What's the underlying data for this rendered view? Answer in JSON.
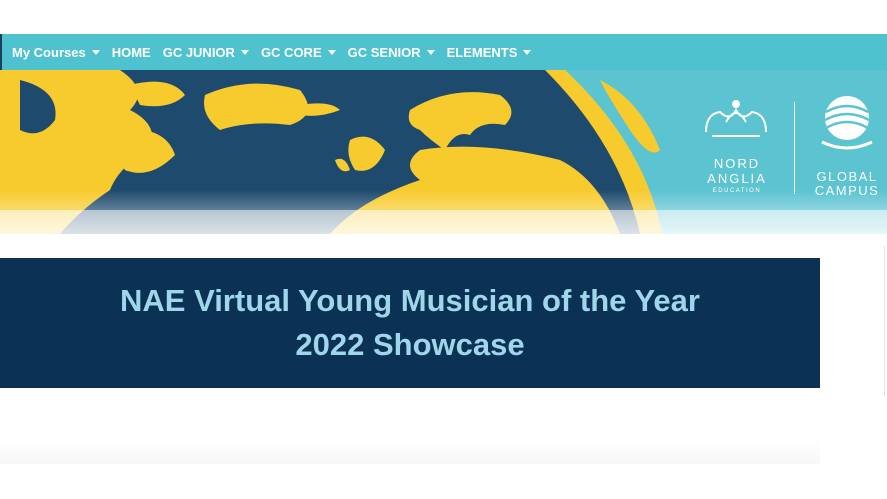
{
  "nav": {
    "items": [
      {
        "label": "My Courses",
        "dropdown": true
      },
      {
        "label": "HOME",
        "dropdown": false
      },
      {
        "label": "GC JUNIOR",
        "dropdown": true
      },
      {
        "label": "GC CORE",
        "dropdown": true
      },
      {
        "label": "GC SENIOR",
        "dropdown": true
      },
      {
        "label": "ELEMENTS",
        "dropdown": true
      }
    ]
  },
  "logos": {
    "nord_anglia": {
      "line1": "NORD",
      "line2": "ANGLIA",
      "line3": "EDUCATION"
    },
    "global_campus": {
      "line1": "GLOBAL",
      "line2": "CAMPUS"
    }
  },
  "title": {
    "line1": "NAE Virtual Young Musician of the Year",
    "line2": "2022 Showcase"
  },
  "colors": {
    "nav_bg": "#4ec3cf",
    "banner_sky": "#5cc3d1",
    "globe_ocean": "#1e4a6e",
    "land": "#f7cb2d",
    "title_bg": "#0b3154",
    "title_text": "#9fd6ea"
  }
}
